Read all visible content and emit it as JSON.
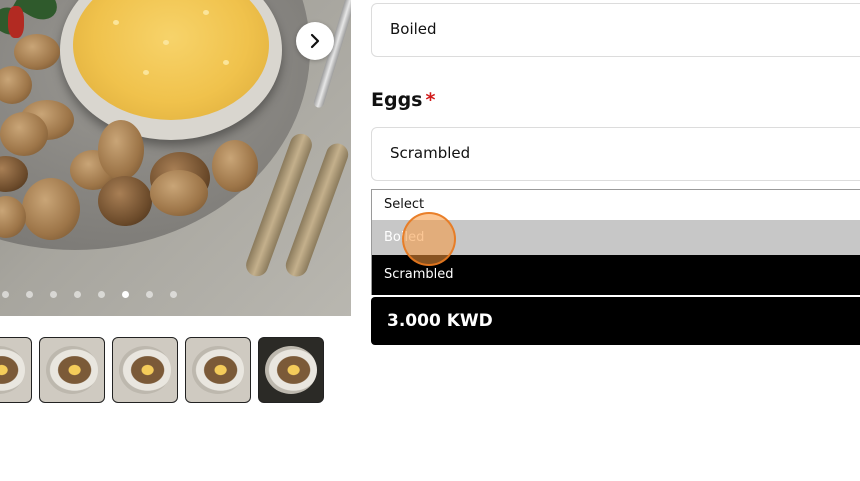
{
  "product": {
    "gallery": {
      "dot_count": 8,
      "active_dot_index": 5,
      "thumbnail_count": 5
    }
  },
  "options": {
    "previous_field": {
      "value": "Boiled"
    },
    "eggs": {
      "label": "Eggs",
      "required_marker": "*",
      "value": "Scrambled",
      "dropdown_options": [
        "Select",
        "Boiled",
        "Scrambled"
      ],
      "highlighted_option": "Boiled",
      "selected_option": "Scrambled"
    }
  },
  "price": {
    "label": "3.000 KWD"
  },
  "colors": {
    "required": "#d11a1a",
    "price_bg": "#000000",
    "highlight": "#c7c7c7",
    "cursor": "#f7983c"
  },
  "icons": {
    "next": "chevron-right-icon"
  }
}
